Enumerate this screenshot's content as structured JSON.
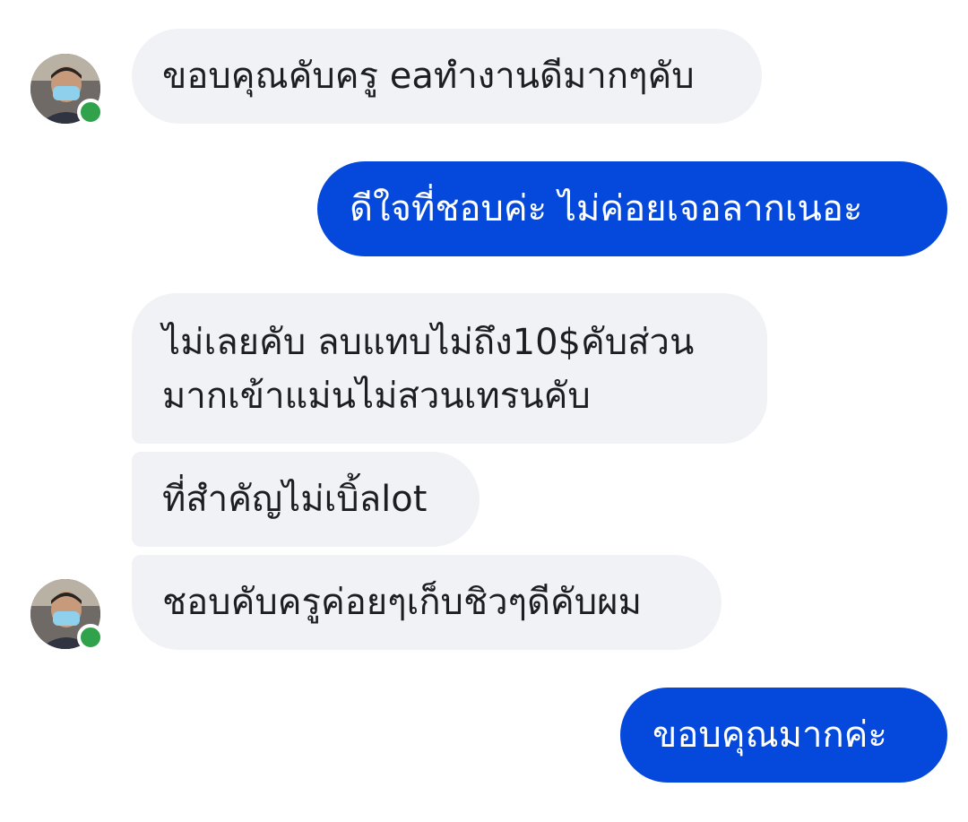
{
  "conversation": {
    "messages": [
      {
        "sender": "contact",
        "lines": [
          "ขอบคุณคับครู eaทำงานดีมากๆคับ"
        ]
      },
      {
        "sender": "me",
        "lines": [
          "ดีใจที่ชอบค่ะ ไม่ค่อยเจอลากเนอะ"
        ]
      },
      {
        "sender": "contact",
        "lines": [
          "ไม่เลยคับ ลบแทบไม่ถึง10$คับส่วน",
          "มากเข้าแม่นไม่สวนเทรนคับ"
        ]
      },
      {
        "sender": "contact",
        "lines": [
          "ที่สำคัญไม่เบิ้ลlot"
        ]
      },
      {
        "sender": "contact",
        "lines": [
          "ชอบคับครูค่อยๆเก็บชิวๆดีคับผม"
        ]
      },
      {
        "sender": "me",
        "lines": [
          "ขอบคุณมากค่ะ"
        ]
      }
    ]
  },
  "theme": {
    "incoming_bubble": "#f1f2f6",
    "outgoing_bubble": "#0548dc",
    "online_indicator": "#31a24c"
  },
  "icons": {
    "avatar": "contact-avatar-photo",
    "presence": "online-status-dot"
  }
}
